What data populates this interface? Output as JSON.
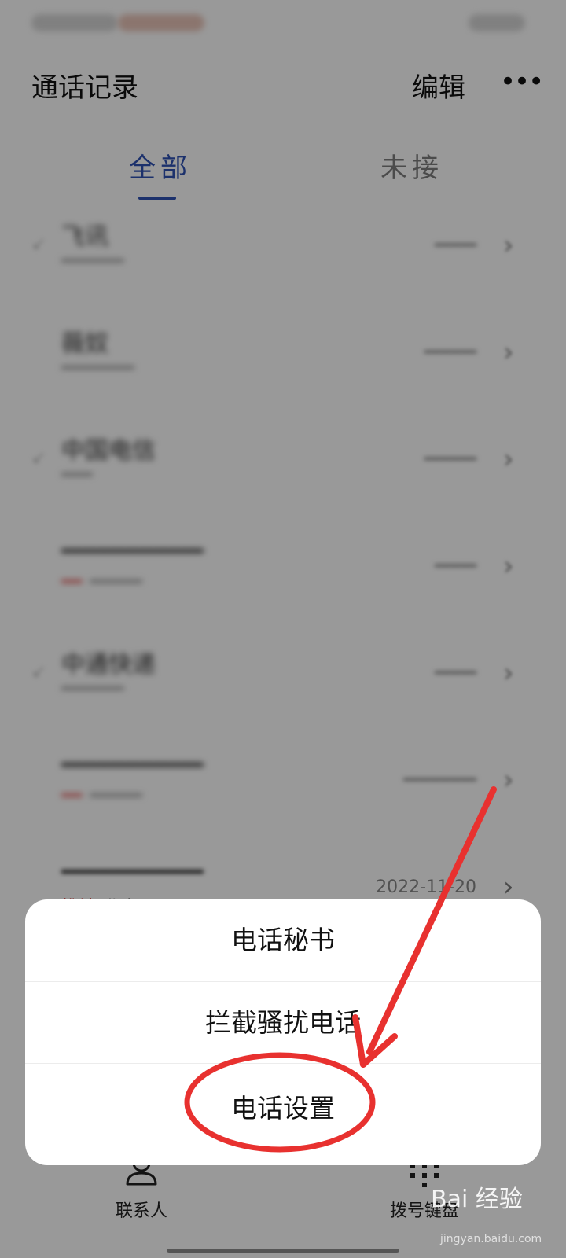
{
  "header": {
    "title": "通话记录",
    "edit_label": "编辑",
    "more_label": "•••"
  },
  "tabs": [
    {
      "label": "全部",
      "active": true
    },
    {
      "label": "未接",
      "active": false
    }
  ],
  "call_list": [
    {
      "name": "飞讯",
      "sub": "",
      "tag": "",
      "date": "",
      "blurred": true
    },
    {
      "name": "薇奴",
      "sub": "",
      "tag": "",
      "date": "",
      "blurred": true
    },
    {
      "name": "中国电信",
      "sub": "",
      "tag": "",
      "date": "",
      "blurred": true
    },
    {
      "name": "",
      "sub": "",
      "tag": "",
      "date": "",
      "blurred": true
    },
    {
      "name": "中通快递",
      "sub": "",
      "tag": "",
      "date": "",
      "blurred": true
    },
    {
      "name": "",
      "sub": "",
      "tag": "",
      "date": "",
      "blurred": true
    },
    {
      "name": "",
      "sub": "北京",
      "tag": "推销",
      "date": "2022-11-20",
      "blurred": false
    }
  ],
  "menu": {
    "items": [
      {
        "label": "电话秘书"
      },
      {
        "label": "拦截骚扰电话"
      },
      {
        "label": "电话设置"
      }
    ],
    "highlighted_item": "电话设置"
  },
  "bottom_nav": {
    "items": [
      {
        "label": "联系人",
        "icon": "person-icon"
      },
      {
        "label": "拨号键盘",
        "icon": "dialpad-icon"
      }
    ]
  },
  "annotation": {
    "color": "#e8312f"
  },
  "watermark": {
    "text": "Bai 经验",
    "url": "jingyan.baidu.com"
  },
  "colors": {
    "accent": "#2f52b5",
    "tag_red": "#e0403f"
  }
}
